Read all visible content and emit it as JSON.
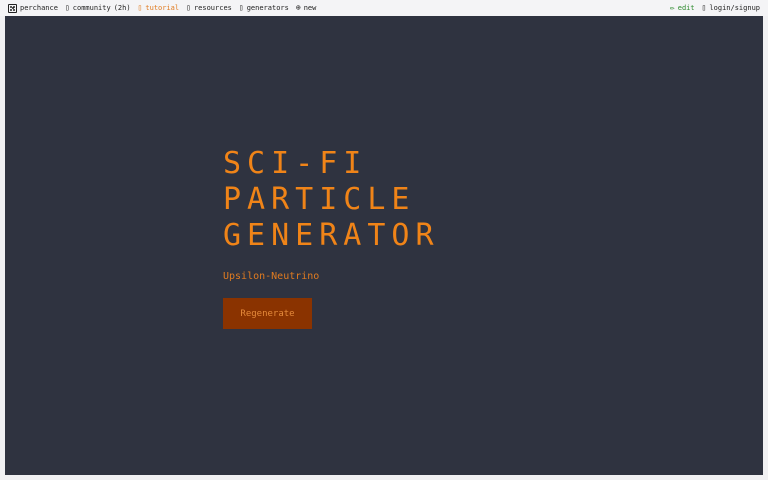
{
  "nav": {
    "left": [
      {
        "name": "nav-perchance",
        "icon": "dice-icon",
        "label": "perchance"
      },
      {
        "name": "nav-community",
        "icon": "chat-icon",
        "label": "community",
        "count": "(2h)"
      },
      {
        "name": "nav-tutorial",
        "icon": "book-icon",
        "label": "tutorial"
      },
      {
        "name": "nav-resources",
        "icon": "folder-icon",
        "label": "resources"
      },
      {
        "name": "nav-generators",
        "icon": "list-icon",
        "label": "generators"
      },
      {
        "name": "nav-new",
        "icon": "plus-circle-icon",
        "label": "new"
      }
    ],
    "right": [
      {
        "name": "nav-edit",
        "icon": "pencil-icon",
        "label": "edit"
      },
      {
        "name": "nav-login",
        "icon": "user-icon",
        "label": "login/signup"
      }
    ]
  },
  "main": {
    "title": "SCI-FI PARTICLE GENERATOR",
    "result": "Upsilon-Neutrino",
    "button_label": "Regenerate"
  },
  "colors": {
    "accent": "#f08418",
    "button_bg": "#8a3300",
    "stage_bg": "#2f3340",
    "edit": "#2e8b2e"
  }
}
